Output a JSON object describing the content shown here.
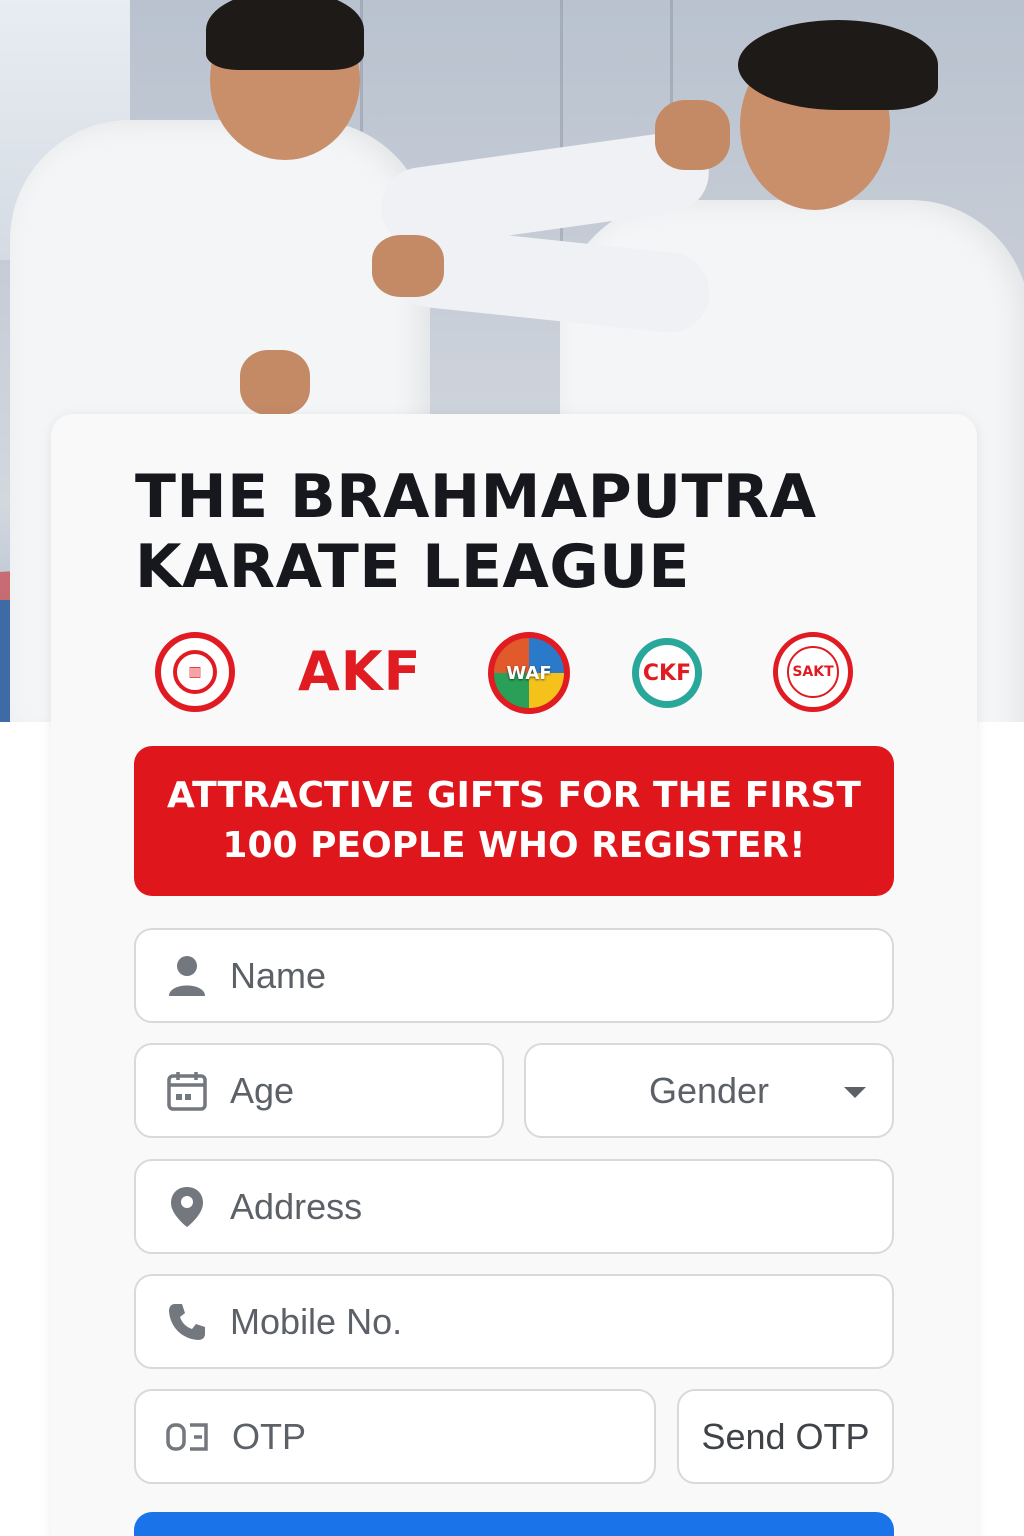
{
  "header": {
    "title_line1": "THE BRAHMAPUTRA",
    "title_line2": "KARATE LEAGUE"
  },
  "logos": [
    {
      "name": "emblem-logo-1"
    },
    {
      "name": "akf-logo",
      "text": "AKF"
    },
    {
      "name": "waf-logo",
      "text": "WAF"
    },
    {
      "name": "ckf-logo",
      "text": "CKF"
    },
    {
      "name": "sakt-logo",
      "text": "SAKT"
    }
  ],
  "banner": {
    "line1": "ATTRACTIVE GIFTS FOR THE FIRST",
    "line2": "100 PEOPLE WHO REGISTER!"
  },
  "form": {
    "name": {
      "placeholder": "Name",
      "icon": "person-icon"
    },
    "age": {
      "placeholder": "Age",
      "icon": "calendar-icon"
    },
    "gender": {
      "value": "Gender",
      "icon": "chevron-down-icon"
    },
    "address": {
      "placeholder": "Address",
      "icon": "location-pin-icon"
    },
    "mobile": {
      "placeholder": "Mobile No.",
      "icon": "phone-icon"
    },
    "otp": {
      "placeholder": "OTP",
      "icon": "otp-icon"
    },
    "send_otp_label": "Send OTP"
  },
  "colors": {
    "brand_red": "#e0161d",
    "submit_blue": "#1a73e8",
    "title_text": "#16181d"
  }
}
